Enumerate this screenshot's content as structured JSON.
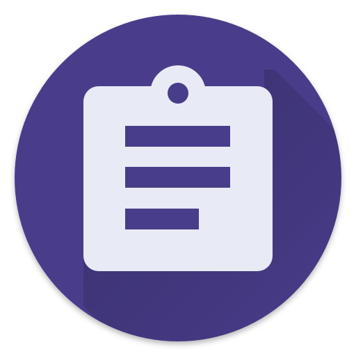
{
  "app_icon": {
    "icon": "clipboard-icon",
    "colors": {
      "background_circle": "#483d8b",
      "long_shadow": "#3a3170",
      "clipboard": "#e8eaf6",
      "text_lines": "#483d8b"
    }
  }
}
